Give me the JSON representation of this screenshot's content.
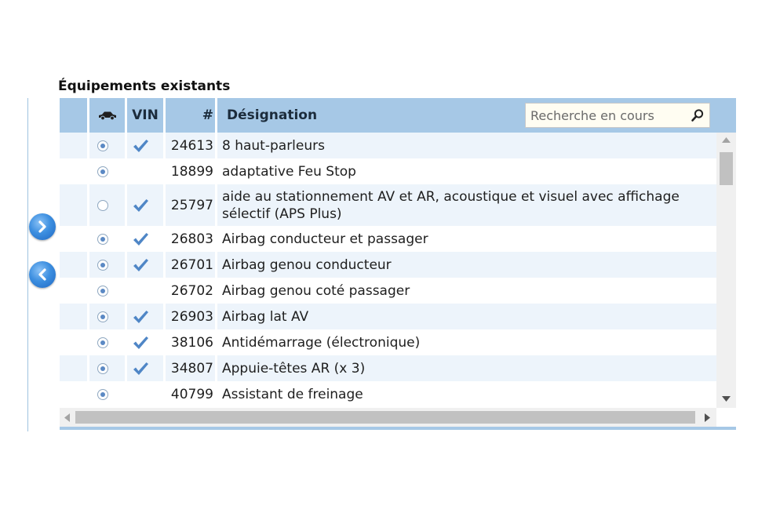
{
  "section_title": "Équipements existants",
  "columns": {
    "car": "car-icon",
    "vin": "VIN",
    "num": "#",
    "designation": "Désignation"
  },
  "search": {
    "placeholder": "Recherche en cours"
  },
  "nav": {
    "add": "arrow-right-icon",
    "remove": "arrow-left-icon"
  },
  "rows": [
    {
      "selected": true,
      "vin": true,
      "num": "24613",
      "designation": "8 haut-parleurs"
    },
    {
      "selected": true,
      "vin": false,
      "num": "18899",
      "designation": "adaptative Feu Stop"
    },
    {
      "selected": false,
      "vin": true,
      "num": "25797",
      "designation": "aide au stationnement AV et AR, acoustique et visuel avec affichage sélectif (APS Plus)"
    },
    {
      "selected": true,
      "vin": true,
      "num": "26803",
      "designation": "Airbag conducteur et passager"
    },
    {
      "selected": true,
      "vin": true,
      "num": "26701",
      "designation": "Airbag genou conducteur"
    },
    {
      "selected": true,
      "vin": false,
      "num": "26702",
      "designation": "Airbag genou coté passager"
    },
    {
      "selected": true,
      "vin": true,
      "num": "26903",
      "designation": "Airbag lat AV"
    },
    {
      "selected": true,
      "vin": true,
      "num": "38106",
      "designation": "Antidémarrage (électronique)"
    },
    {
      "selected": true,
      "vin": true,
      "num": "34807",
      "designation": "Appuie-têtes AR (x 3)"
    },
    {
      "selected": true,
      "vin": false,
      "num": "40799",
      "designation": "Assistant de freinage"
    }
  ],
  "colors": {
    "header": "#a6c8e6",
    "alt_row": "#edf4fb",
    "check": "#4f86c6",
    "nav_button": "#3d8fe0"
  }
}
